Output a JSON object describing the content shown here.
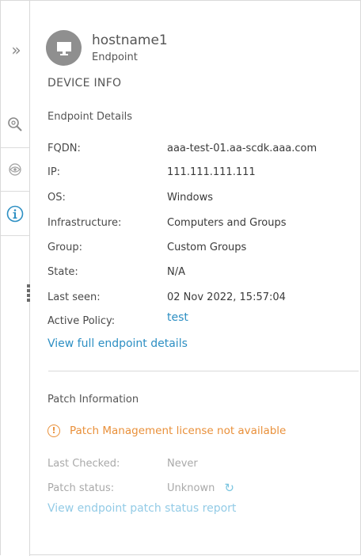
{
  "rail": {
    "expand_icon": "double-chevron-right-icon",
    "investigate_icon": "search-investigate-icon",
    "visibility_icon": "eye-icon",
    "info_icon": "info-icon",
    "active_color": "#2d8fc3"
  },
  "header": {
    "hostname": "hostname1",
    "type": "Endpoint",
    "avatar_icon": "monitor-icon"
  },
  "device_info": {
    "title": "DEVICE INFO",
    "group_title": "Endpoint Details",
    "fields": [
      {
        "label": "FQDN:",
        "value": "aaa-test-01.aa-scdk.aaa.com"
      },
      {
        "label": "IP:",
        "value": "111.111.111.111"
      },
      {
        "label": "OS:",
        "value": "Windows"
      },
      {
        "label": "Infrastructure:",
        "value": "Computers and Groups"
      },
      {
        "label": "Group:",
        "value": "Custom Groups"
      },
      {
        "label": "State:",
        "value": "N/A"
      },
      {
        "label": "Last seen:",
        "value": "02 Nov 2022, 15:57:04"
      },
      {
        "label": "Active Policy:",
        "value": "test"
      }
    ],
    "view_full_link": "View full endpoint details"
  },
  "patch": {
    "title": "Patch Information",
    "warning": "Patch Management license not available",
    "warning_color": "#e9903a",
    "last_checked_label": "Last Checked:",
    "last_checked_value": "Never",
    "status_label": "Patch status:",
    "status_value": "Unknown",
    "report_link": "View endpoint patch status report"
  }
}
